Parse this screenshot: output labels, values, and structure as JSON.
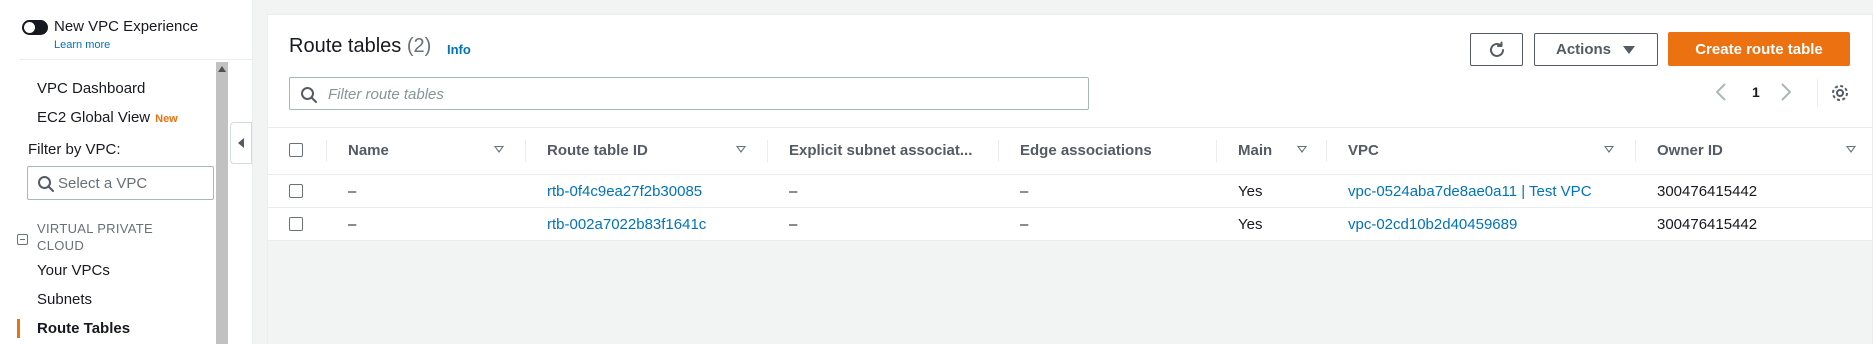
{
  "sidebar": {
    "new_vpc_experience": "New VPC Experience",
    "learn_more": "Learn more",
    "items": {
      "vpc_dashboard": "VPC Dashboard",
      "ec2_global_view": "EC2 Global View",
      "ec2_global_view_badge": "New",
      "your_vpcs": "Your VPCs",
      "subnets": "Subnets",
      "route_tables": "Route Tables"
    },
    "filter_label": "Filter by VPC:",
    "vpc_select_placeholder": "Select a VPC",
    "section_title": "VIRTUAL PRIVATE CLOUD",
    "active_item": "Route Tables",
    "accent_color": "#ec7211"
  },
  "header": {
    "title": "Route tables",
    "count": "(2)",
    "info": "Info",
    "actions_label": "Actions",
    "create_label": "Create route table",
    "refresh_icon": "refresh-icon"
  },
  "search": {
    "placeholder": "Filter route tables"
  },
  "pagination": {
    "current_page": "1"
  },
  "table": {
    "columns": [
      "Name",
      "Route table ID",
      "Explicit subnet associat...",
      "Edge associations",
      "Main",
      "VPC",
      "Owner ID"
    ],
    "rows": [
      {
        "name": "–",
        "route_table_id": "rtb-0f4c9ea27f2b30085",
        "explicit_subnet": "–",
        "edge": "–",
        "main": "Yes",
        "vpc": "vpc-0524aba7de8ae0a11 | Test VPC",
        "owner_id": "300476415442"
      },
      {
        "name": "–",
        "route_table_id": "rtb-002a7022b83f1641c",
        "explicit_subnet": "–",
        "edge": "–",
        "main": "Yes",
        "vpc": "vpc-02cd10b2d40459689",
        "owner_id": "300476415442"
      }
    ]
  },
  "colors": {
    "link": "#0073bb",
    "primary_button": "#ec7211"
  }
}
